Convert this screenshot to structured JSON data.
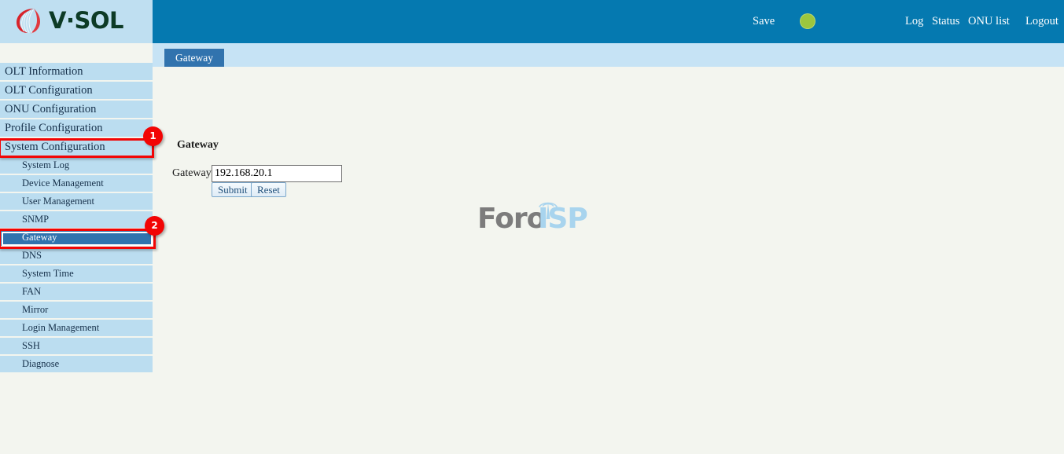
{
  "brand": {
    "logo_text": "V·SOL",
    "logo_icon": "vsol-shell-icon"
  },
  "header": {
    "save_label": "Save",
    "status_indicator": "green-status-dot",
    "status_color": "#9cc63e",
    "links": {
      "log": "Log",
      "status": "Status",
      "onu_list": "ONU list",
      "logout": "Logout"
    },
    "background_color": "#0579b0"
  },
  "tabs": [
    {
      "label": "Gateway",
      "active": true
    }
  ],
  "content": {
    "section_title": "Gateway",
    "form": {
      "gateway_label": "Gateway",
      "gateway_value": "192.168.20.1",
      "gateway_placeholder": "",
      "submit_label": "Submit",
      "reset_label": "Reset"
    },
    "watermark": {
      "part1": "Foro",
      "part2": "ISP",
      "icon": "antenna-tower-icon"
    }
  },
  "sidebar": {
    "top_items": [
      {
        "label": "OLT Information"
      },
      {
        "label": "OLT Configuration"
      },
      {
        "label": "ONU Configuration"
      },
      {
        "label": "Profile Configuration"
      },
      {
        "label": "System Configuration",
        "highlighted": true
      }
    ],
    "sub_items": [
      {
        "label": "System Log"
      },
      {
        "label": "Device Management"
      },
      {
        "label": "User Management"
      },
      {
        "label": "SNMP"
      },
      {
        "label": "Gateway",
        "selected": true
      },
      {
        "label": "DNS"
      },
      {
        "label": "System Time"
      },
      {
        "label": "FAN"
      },
      {
        "label": "Mirror"
      },
      {
        "label": "Login Management"
      },
      {
        "label": "SSH"
      },
      {
        "label": "Diagnose"
      }
    ]
  },
  "annotations": [
    {
      "number": "1",
      "target": "System Configuration",
      "color": "#f20505"
    },
    {
      "number": "2",
      "target": "Gateway",
      "color": "#f20505"
    }
  ]
}
